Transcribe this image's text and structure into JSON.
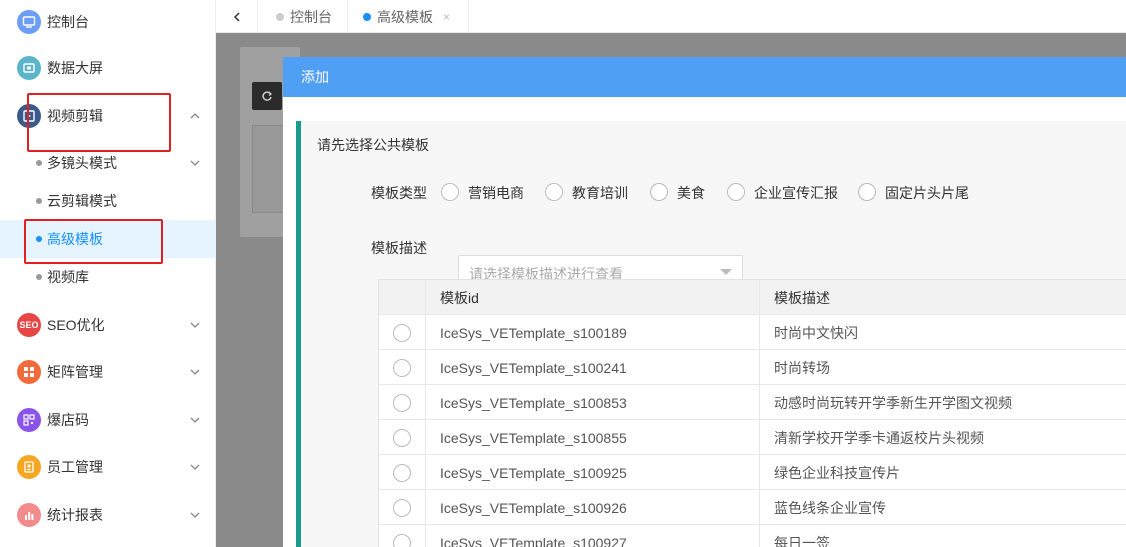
{
  "sidebar": {
    "items": [
      {
        "label": "控制台",
        "icon": "monitor-icon",
        "color": "#6c9ef5"
      },
      {
        "label": "数据大屏",
        "icon": "screen-icon",
        "color": "#5bb5c9"
      },
      {
        "label": "视频剪辑",
        "icon": "video-edit-icon",
        "color": "#3a5a8c"
      },
      {
        "label": "SEO优化",
        "icon": "seo-icon",
        "color": "#e84545"
      },
      {
        "label": "矩阵管理",
        "icon": "matrix-icon",
        "color": "#f26b3a"
      },
      {
        "label": "爆店码",
        "icon": "qrcode-icon",
        "color": "#8a54e8"
      },
      {
        "label": "员工管理",
        "icon": "staff-icon",
        "color": "#f5a623"
      },
      {
        "label": "统计报表",
        "icon": "chart-icon",
        "color": "#f28b8b"
      }
    ],
    "sub_items": [
      {
        "label": "多镜头模式"
      },
      {
        "label": "云剪辑模式"
      },
      {
        "label": "高级模板"
      },
      {
        "label": "视频库"
      }
    ],
    "seo_badge": "SEO"
  },
  "tabs": [
    {
      "label": "控制台"
    },
    {
      "label": "高级模板",
      "close": "×"
    }
  ],
  "modal": {
    "title": "添加",
    "section_title": "请先选择公共模板",
    "type_label": "模板类型",
    "types": [
      "营销电商",
      "教育培训",
      "美食",
      "企业宣传汇报",
      "固定片头片尾"
    ],
    "desc_label": "模板描述",
    "desc_placeholder": "请选择模板描述进行查看"
  },
  "table": {
    "headers": [
      "",
      "模板id",
      "模板描述"
    ],
    "rows": [
      {
        "id": "IceSys_VETemplate_s100189",
        "desc": "时尚中文快闪"
      },
      {
        "id": "IceSys_VETemplate_s100241",
        "desc": "时尚转场"
      },
      {
        "id": "IceSys_VETemplate_s100853",
        "desc": "动感时尚玩转开学季新生开学图文视频"
      },
      {
        "id": "IceSys_VETemplate_s100855",
        "desc": "清新学校开学季卡通返校片头视频"
      },
      {
        "id": "IceSys_VETemplate_s100925",
        "desc": "绿色企业科技宣传片"
      },
      {
        "id": "IceSys_VETemplate_s100926",
        "desc": "蓝色线条企业宣传"
      },
      {
        "id": "IceSys_VETemplate_s100927",
        "desc": "每日一签"
      }
    ]
  },
  "colors": {
    "accent": "#1890ff",
    "modal_header": "#4f9ff5",
    "panel_border": "#1a9c8c",
    "highlight_box": "#e02020"
  }
}
